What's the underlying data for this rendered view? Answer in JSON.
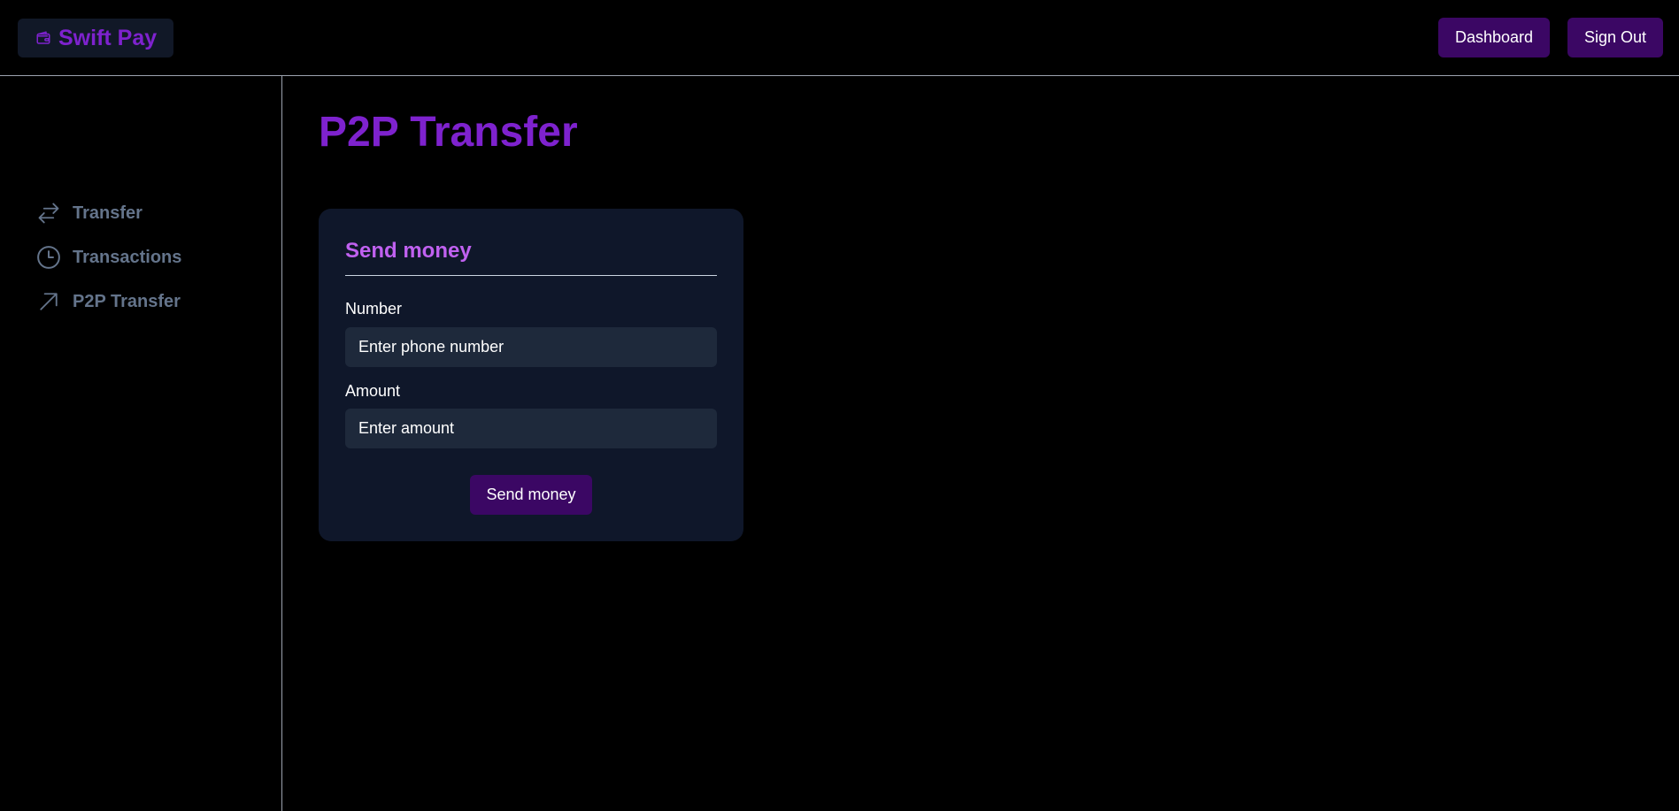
{
  "header": {
    "brand": {
      "name": "Swift Pay",
      "icon": "wallet-icon"
    },
    "dashboard_label": "Dashboard",
    "signout_label": "Sign Out"
  },
  "sidebar": {
    "items": [
      {
        "label": "Transfer",
        "icon": "arrows-left-right-icon"
      },
      {
        "label": "Transactions",
        "icon": "clock-icon"
      },
      {
        "label": "P2P Transfer",
        "icon": "arrow-up-right-icon"
      }
    ]
  },
  "main": {
    "title": "P2P Transfer",
    "card": {
      "title": "Send money",
      "number_label": "Number",
      "number_placeholder": "Enter phone number",
      "amount_label": "Amount",
      "amount_placeholder": "Enter amount",
      "submit_label": "Send money"
    }
  },
  "colors": {
    "background": "#000000",
    "brand_purple": "#7e22ce",
    "card_title": "#c061f0",
    "button_bg": "#3b0764",
    "card_bg": "#0f172a",
    "input_bg": "#1e293b",
    "nav_text": "#64748b"
  }
}
